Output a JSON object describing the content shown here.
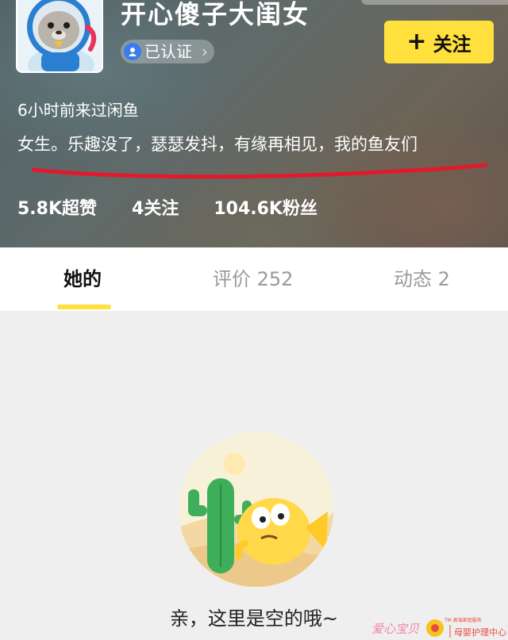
{
  "profile": {
    "username": "开心傻子大闺女",
    "verified_label": "已认证",
    "follow_label": "关注",
    "last_visit": "6小时前来过闲鱼",
    "bio": "女生。乐趣没了，瑟瑟发抖，有缘再相见，我的鱼友们"
  },
  "stats": [
    {
      "label": "5.8K超赞"
    },
    {
      "label": "4关注"
    },
    {
      "label": "104.6K粉丝"
    }
  ],
  "tabs": [
    {
      "label": "她的",
      "active": true
    },
    {
      "label": "评价 252",
      "active": false
    },
    {
      "label": "动态 2",
      "active": false
    }
  ],
  "empty_state": {
    "message": "亲，这里是空的哦~"
  },
  "watermark": {
    "brand": "爱心宝贝",
    "subtitle": "母婴护理中心",
    "tm_note": "TM 高端家庭服务"
  },
  "colors": {
    "accent": "#ffe03d",
    "underline_mark": "#e2192c",
    "verify_blue": "#3a7bf0"
  }
}
